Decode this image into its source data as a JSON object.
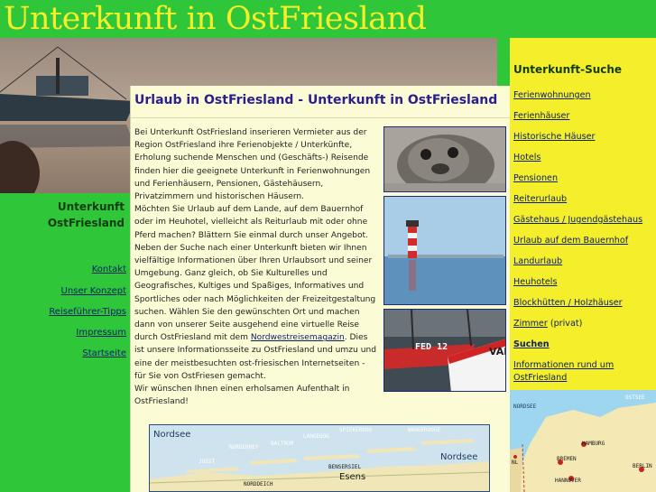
{
  "site": {
    "title": "Unterkunft in OstFriesland"
  },
  "left_sidebar": {
    "brand_line1": "Unterkunft",
    "brand_line2": "OstFriesland",
    "links": [
      {
        "label": "Kontakt"
      },
      {
        "label": "Unser Konzept"
      },
      {
        "label": "Reiseführer-Tipps"
      },
      {
        "label": "Impressum"
      },
      {
        "label": "Startseite"
      }
    ]
  },
  "main": {
    "title": "Urlaub in OstFriesland - Unterkunft in OstFriesland",
    "para1": "Bei Unterkunft OstFriesland inserieren Vermieter aus der Region OstFriesland ihre Ferienobjekte / Unterkünfte, Erholung suchende Menschen und (Geschäfts-) Reisende finden hier die geeignete Unterkunft in Ferienwohnungen und Ferienhäusern, Pensionen, Gästehäusern, Privatzimmern und historischen Häusern.",
    "para2": "Möchten Sie Urlaub auf dem Lande, auf dem Bauernhof oder im Heuhotel, vielleicht als Reiturlaub mit oder ohne Pferd machen? Blättern Sie einmal durch unser Angebot.",
    "para3_before": "Neben der Suche nach einer Unterkunft bieten wir Ihnen vielfältige Informationen über Ihren Urlaubsort und seiner Umgebung. Ganz gleich, ob Sie Kulturelles und Geografisches, Kultiges und Spaßiges, Informatives und Sportliches oder nach Möglichkeiten der Freizeitgestaltung suchen. Wählen Sie den gewünschten Ort und machen dann von unserer Seite ausgehend eine virtuelle Reise durch OstFriesland mit dem ",
    "para3_link": "Nordwestreisemagazin",
    "para3_after": ". Dies ist unsere Informationsseite zu OstFriesland und umzu und eine der meistbesuchten ost-friesischen Internetseiten - für Sie von OstFriesen gemacht.",
    "para4": "Wir wünschen Ihnen einen erholsamen Aufenthalt in OstFriesland!"
  },
  "photos": {
    "boat_label_1": "FED 12",
    "boat_label_2": "VAR"
  },
  "map": {
    "labels": {
      "nordsee_left": "Nordsee",
      "nordsee_right": "Nordsee",
      "spiekeroog": "SPIEKEROOG",
      "wangerooge": "WANGEROOGE",
      "langeoog": "LANGEOOG",
      "baltrum": "BALTRUM",
      "norderney": "NORDERNEY",
      "juist": "JUIST",
      "bensersiel": "BENSERSIEL",
      "esens": "Esens",
      "norddeich": "NORDDEICH"
    }
  },
  "right_sidebar": {
    "heading": "Unterkunft-Suche",
    "items": [
      {
        "label": "Ferienwohnungen"
      },
      {
        "label": "Ferienhäuser"
      },
      {
        "label": "Historische Häuser"
      },
      {
        "label": "Hotels"
      },
      {
        "label": "Pensionen"
      },
      {
        "label": "Reiterurlaub"
      },
      {
        "label": "Gästehaus / Jugendgästehaus"
      },
      {
        "label": "Urlaub auf dem Bauernhof"
      },
      {
        "label": "Landurlaub"
      },
      {
        "label": "Heuhotels"
      },
      {
        "label": "Blockhütten / Holzhäuser"
      },
      {
        "label": "Zimmer",
        "note": " (privat)"
      },
      {
        "label": "Suchen"
      },
      {
        "label": "Informationen rund um OstFriesland"
      }
    ]
  },
  "locator_map": {
    "labels": {
      "ostsee": "OSTSEE",
      "nordsee": "NORDSEE",
      "hamburg": "HAMBURG",
      "bremen": "BREMEN",
      "hannover": "HANNOVER",
      "berlin": "BERLIN",
      "nl": "NL"
    }
  },
  "colors": {
    "header_green": "#2fc63a",
    "title_yellow": "#f5ee2a",
    "panel_cream": "#fbfcd6",
    "link_blue": "#0b1f66",
    "title_blue": "#2a1f8f"
  }
}
